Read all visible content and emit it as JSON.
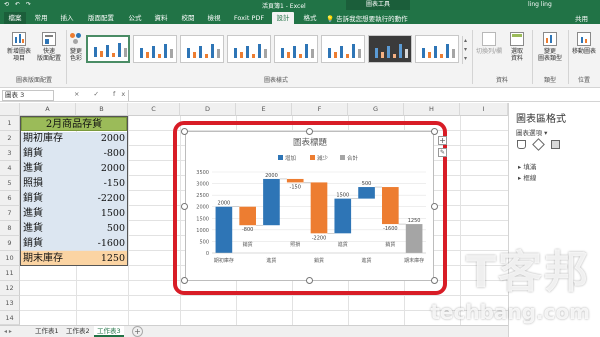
{
  "window": {
    "quick_access": "⟲ ↶ ↷",
    "doc_title": "活頁簿1 - Excel",
    "context_title": "圖表工具",
    "user": "ling ling"
  },
  "ribbon_tabs": [
    "檔案",
    "常用",
    "插入",
    "版面配置",
    "公式",
    "資料",
    "校閱",
    "檢視",
    "Foxit PDF",
    "設計",
    "格式"
  ],
  "active_tab": "設計",
  "tell_me": "告訴我您想要執行的動作",
  "share": "共用",
  "ribbon": {
    "add_element": "新增圖表\n項目",
    "quick_layout": "快速\n版面配置",
    "change_colors": "變更\n色彩",
    "switch_row_col": "切換列/欄",
    "select_data": "選取\n資料",
    "change_type": "變更\n圖表類型",
    "move_chart": "移動圖表",
    "group_layouts": "圖表版面配置",
    "group_styles": "圖表樣式",
    "group_data": "資料",
    "group_type": "類型",
    "group_location": "位置"
  },
  "formula_bar": {
    "name_box": "圖表 3",
    "icons": "× ✓ fx",
    "formula": ""
  },
  "columns": [
    "A",
    "B",
    "C",
    "D",
    "E",
    "F",
    "G",
    "H",
    "I"
  ],
  "rows": [
    "1",
    "2",
    "3",
    "4",
    "5",
    "6",
    "7",
    "8",
    "9",
    "10",
    "11",
    "12",
    "13",
    "14"
  ],
  "sheet_cells": {
    "title": "2月商品存貨",
    "labels": [
      "期初庫存",
      "銷貨",
      "進貨",
      "照損",
      "銷貨",
      "進貨",
      "進貨",
      "銷貨",
      "期末庫存"
    ],
    "values": [
      "2000",
      "-800",
      "2000",
      "-150",
      "-2200",
      "1500",
      "500",
      "-1600",
      "1250"
    ]
  },
  "sheet_tabs": [
    "工作表1",
    "工作表2",
    "工作表3"
  ],
  "active_sheet": "工作表3",
  "add_sheet": "+",
  "pane": {
    "title": "圖表區格式",
    "options": "圖表選項 ▾",
    "fill": "▸ 填滿",
    "border": "▸ 框線"
  },
  "colors": {
    "excel_green": "#217346",
    "increase": "#2e75b6",
    "decrease": "#ed7d31",
    "total": "#a5a5a5",
    "highlight_frame": "#d81c26",
    "title_cell": "#9bbb59"
  },
  "chart_data": {
    "type": "bar",
    "subtype": "waterfall",
    "title": "圖表標題",
    "legend": [
      "增加",
      "減少",
      "合計"
    ],
    "legend_position": "top",
    "categories": [
      "期初庫存",
      "銷貨",
      "進貨",
      "照損",
      "銷貨",
      "進貨",
      "進貨",
      "銷貨",
      "期末庫存"
    ],
    "x_tick_labels_shown": [
      "期初庫存",
      "進貨",
      "銷貨",
      "進貨",
      "期末庫存"
    ],
    "x_tick_labels_upper": [
      "銷貨",
      "照損",
      "進貨",
      "銷貨"
    ],
    "values": [
      2000,
      -800,
      2000,
      -150,
      -2200,
      1500,
      500,
      -1600,
      1250
    ],
    "data_labels": [
      "2000",
      "-800",
      "2000",
      "-150",
      "-2200",
      "1500",
      "500",
      "-1600",
      "1250"
    ],
    "kinds": [
      "increase",
      "decrease",
      "increase",
      "decrease",
      "decrease",
      "increase",
      "increase",
      "decrease",
      "total"
    ],
    "y_ticks": [
      "3500",
      "3000",
      "2500",
      "2000",
      "1500",
      "1000",
      "500",
      "0"
    ],
    "ylim": [
      0,
      3500
    ],
    "grid": true
  },
  "watermark": {
    "line1": "T客邦",
    "line2": "techbang.com"
  }
}
